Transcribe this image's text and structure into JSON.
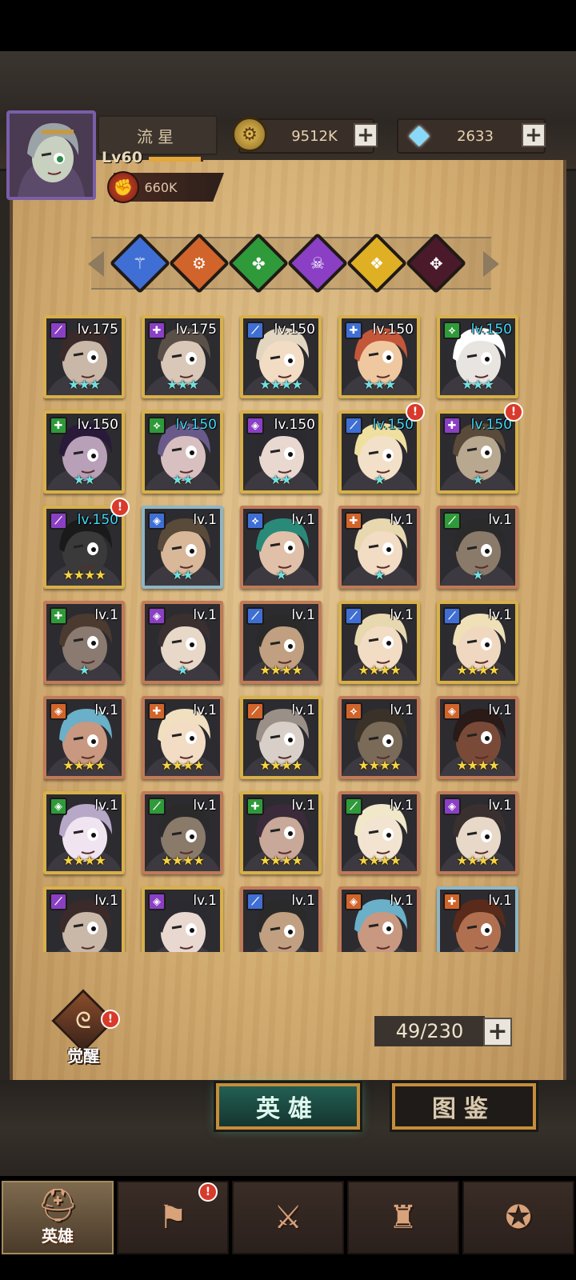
{
  "player": {
    "name": "流星",
    "level": "Lv60",
    "power": "660K",
    "xp_fraction": 0.95
  },
  "resources": {
    "gold": "9512K",
    "diamonds": "2633"
  },
  "factions": [
    {
      "name": "faction-blue",
      "color": "#3f6fd4",
      "glyph": "⚚"
    },
    {
      "name": "faction-orange",
      "color": "#d0642a",
      "glyph": "⚙"
    },
    {
      "name": "faction-green",
      "color": "#2f9a3a",
      "glyph": "✤"
    },
    {
      "name": "faction-purple",
      "color": "#8a3fc4",
      "glyph": "☠"
    },
    {
      "name": "faction-gold",
      "color": "#e0b024",
      "glyph": "❖"
    },
    {
      "name": "faction-dark",
      "color": "#4a1a2a",
      "glyph": "✥"
    }
  ],
  "heroes": [
    {
      "level": "lv.175",
      "stars": "★★★",
      "class_color": "#8a3fc4",
      "class_glyph": "⟋",
      "level_color": "white",
      "star_color": "teal",
      "frame": "gold",
      "skin": "#c9b8a8",
      "hair": "#3a2a2a",
      "badge": false
    },
    {
      "level": "lv.175",
      "stars": "★★★",
      "class_color": "#8a3fc4",
      "class_glyph": "✚",
      "level_color": "white",
      "star_color": "teal",
      "frame": "gold",
      "skin": "#d9c8b8",
      "hair": "#5a5048",
      "badge": false
    },
    {
      "level": "lv.150",
      "stars": "★★★★",
      "class_color": "#3f6fd4",
      "class_glyph": "⟋",
      "level_color": "white",
      "star_color": "teal",
      "frame": "gold",
      "skin": "#f2dcc4",
      "hair": "#e2d6c0",
      "badge": false
    },
    {
      "level": "lv.150",
      "stars": "★★★",
      "class_color": "#3f6fd4",
      "class_glyph": "✚",
      "level_color": "white",
      "star_color": "teal",
      "frame": "gold",
      "skin": "#f0c8a0",
      "hair": "#c4563a",
      "badge": false
    },
    {
      "level": "lv.150",
      "stars": "★★★",
      "class_color": "#2f9a3a",
      "class_glyph": "⟡",
      "level_color": "blue",
      "star_color": "teal",
      "frame": "gold",
      "skin": "#e8e4e0",
      "hair": "#ffffff",
      "badge": false
    },
    {
      "level": "lv.150",
      "stars": "★★",
      "class_color": "#2f9a3a",
      "class_glyph": "✚",
      "level_color": "white",
      "star_color": "teal",
      "frame": "gold",
      "skin": "#b8a0b8",
      "hair": "#2a1a3a",
      "badge": false
    },
    {
      "level": "lv.150",
      "stars": "★★",
      "class_color": "#2f9a3a",
      "class_glyph": "⟡",
      "level_color": "blue",
      "star_color": "teal",
      "frame": "gold",
      "skin": "#d8c0c0",
      "hair": "#6a5a8a",
      "badge": false
    },
    {
      "level": "lv.150",
      "stars": "★★",
      "class_color": "#8a3fc4",
      "class_glyph": "◈",
      "level_color": "white",
      "star_color": "teal",
      "frame": "gold",
      "skin": "#e8d8d0",
      "hair": "#2a2a30",
      "badge": false
    },
    {
      "level": "lv.150",
      "stars": "★",
      "class_color": "#3f6fd4",
      "class_glyph": "⟋",
      "level_color": "blue",
      "star_color": "teal",
      "frame": "gold",
      "skin": "#f2e0c8",
      "hair": "#f0e0a0",
      "badge": true
    },
    {
      "level": "lv.150",
      "stars": "★",
      "class_color": "#8a3fc4",
      "class_glyph": "✚",
      "level_color": "blue",
      "star_color": "teal",
      "frame": "gold",
      "skin": "#b8a890",
      "hair": "#5a4a3a",
      "badge": true
    },
    {
      "level": "lv.150",
      "stars": "★★★★",
      "class_color": "#8a3fc4",
      "class_glyph": "⟋",
      "level_color": "blue",
      "star_color": "gold",
      "frame": "gold",
      "skin": "#3a3a3a",
      "hair": "#1a1a1a",
      "badge": true
    },
    {
      "level": "lv.1",
      "stars": "★★",
      "class_color": "#3f6fd4",
      "class_glyph": "◈",
      "level_color": "white",
      "star_color": "teal",
      "frame": "blue",
      "skin": "#d8b898",
      "hair": "#5a4a3a",
      "badge": false
    },
    {
      "level": "lv.1",
      "stars": "★",
      "class_color": "#3f6fd4",
      "class_glyph": "⟡",
      "level_color": "white",
      "star_color": "teal",
      "frame": "copper",
      "skin": "#e0c0a8",
      "hair": "#2a8a7a",
      "badge": false
    },
    {
      "level": "lv.1",
      "stars": "★",
      "class_color": "#d0642a",
      "class_glyph": "✚",
      "level_color": "white",
      "star_color": "teal",
      "frame": "copper",
      "skin": "#f2dcc4",
      "hair": "#e8d8b0",
      "badge": false
    },
    {
      "level": "lv.1",
      "stars": "★",
      "class_color": "#2f9a3a",
      "class_glyph": "⟋",
      "level_color": "white",
      "star_color": "teal",
      "frame": "copper",
      "skin": "#8a7a6a",
      "hair": "#2a2a2a",
      "badge": false
    },
    {
      "level": "lv.1",
      "stars": "★",
      "class_color": "#2f9a3a",
      "class_glyph": "✚",
      "level_color": "white",
      "star_color": "teal",
      "frame": "copper",
      "skin": "#8a7a70",
      "hair": "#4a3a30",
      "badge": false
    },
    {
      "level": "lv.1",
      "stars": "★",
      "class_color": "#8a3fc4",
      "class_glyph": "◈",
      "level_color": "white",
      "star_color": "teal",
      "frame": "copper",
      "skin": "#e8d8c8",
      "hair": "#3a3030",
      "badge": false
    },
    {
      "level": "lv.1",
      "stars": "★★★★",
      "class_color": "#3f6fd4",
      "class_glyph": "⟋",
      "level_color": "white",
      "star_color": "gold",
      "frame": "copper",
      "skin": "#c0a080",
      "hair": "#2a2a2a",
      "badge": false
    },
    {
      "level": "lv.1",
      "stars": "★★★★",
      "class_color": "#3f6fd4",
      "class_glyph": "⟋",
      "level_color": "white",
      "star_color": "gold",
      "frame": "gold",
      "skin": "#f2dcc4",
      "hair": "#e8d8b0",
      "badge": false
    },
    {
      "level": "lv.1",
      "stars": "★★★★",
      "class_color": "#3f6fd4",
      "class_glyph": "⟋",
      "level_color": "white",
      "star_color": "gold",
      "frame": "gold",
      "skin": "#f0d8c0",
      "hair": "#f0e0b8",
      "badge": false
    },
    {
      "level": "lv.1",
      "stars": "★★★★",
      "class_color": "#d0642a",
      "class_glyph": "◈",
      "level_color": "white",
      "star_color": "gold",
      "frame": "copper",
      "skin": "#c89880",
      "hair": "#6ab0c8",
      "badge": false
    },
    {
      "level": "lv.1",
      "stars": "★★★★",
      "class_color": "#d0642a",
      "class_glyph": "✚",
      "level_color": "white",
      "star_color": "gold",
      "frame": "copper",
      "skin": "#f2dcc4",
      "hair": "#f0e0c0",
      "badge": false
    },
    {
      "level": "lv.1",
      "stars": "★★★★",
      "class_color": "#d0642a",
      "class_glyph": "⟋",
      "level_color": "white",
      "star_color": "gold",
      "frame": "gold",
      "skin": "#d8d0c8",
      "hair": "#9a9088",
      "badge": false
    },
    {
      "level": "lv.1",
      "stars": "★★★★",
      "class_color": "#d0642a",
      "class_glyph": "⟡",
      "level_color": "white",
      "star_color": "gold",
      "frame": "copper",
      "skin": "#7a6a58",
      "hair": "#3a3228",
      "badge": false
    },
    {
      "level": "lv.1",
      "stars": "★★★★",
      "class_color": "#d0642a",
      "class_glyph": "◈",
      "level_color": "white",
      "star_color": "gold",
      "frame": "copper",
      "skin": "#7a4a38",
      "hair": "#2a1a18",
      "badge": false
    },
    {
      "level": "lv.1",
      "stars": "★★★★",
      "class_color": "#2f9a3a",
      "class_glyph": "◈",
      "level_color": "white",
      "star_color": "gold",
      "frame": "gold",
      "skin": "#f0e4f0",
      "hair": "#b8a8c8",
      "badge": false
    },
    {
      "level": "lv.1",
      "stars": "★★★★",
      "class_color": "#2f9a3a",
      "class_glyph": "⟋",
      "level_color": "white",
      "star_color": "gold",
      "frame": "copper",
      "skin": "#8a7a6a",
      "hair": "#2a2a2a",
      "badge": false
    },
    {
      "level": "lv.1",
      "stars": "★★★★",
      "class_color": "#2f9a3a",
      "class_glyph": "✚",
      "level_color": "white",
      "star_color": "gold",
      "frame": "gold",
      "skin": "#c8a898",
      "hair": "#3a2a3a",
      "badge": false
    },
    {
      "level": "lv.1",
      "stars": "★★★★",
      "class_color": "#2f9a3a",
      "class_glyph": "⟋",
      "level_color": "white",
      "star_color": "gold",
      "frame": "copper",
      "skin": "#f2e4d0",
      "hair": "#f0e8c8",
      "badge": false
    },
    {
      "level": "lv.1",
      "stars": "★★★★",
      "class_color": "#8a3fc4",
      "class_glyph": "◈",
      "level_color": "white",
      "star_color": "gold",
      "frame": "copper",
      "skin": "#e8d8c8",
      "hair": "#3a3030",
      "badge": false
    },
    {
      "level": "lv.1",
      "stars": "",
      "class_color": "#8a3fc4",
      "class_glyph": "⟋",
      "level_color": "white",
      "star_color": "gold",
      "frame": "gold",
      "skin": "#c9b8a8",
      "hair": "#3a2a2a",
      "badge": false
    },
    {
      "level": "lv.1",
      "stars": "",
      "class_color": "#8a3fc4",
      "class_glyph": "◈",
      "level_color": "white",
      "star_color": "gold",
      "frame": "gold",
      "skin": "#e8d8d0",
      "hair": "#2a2a30",
      "badge": false
    },
    {
      "level": "lv.1",
      "stars": "",
      "class_color": "#3f6fd4",
      "class_glyph": "⟋",
      "level_color": "white",
      "star_color": "gold",
      "frame": "copper",
      "skin": "#c0a080",
      "hair": "#2a2a2a",
      "badge": false
    },
    {
      "level": "lv.1",
      "stars": "",
      "class_color": "#d0642a",
      "class_glyph": "◈",
      "level_color": "white",
      "star_color": "gold",
      "frame": "copper",
      "skin": "#c89880",
      "hair": "#6ab0c8",
      "badge": false
    },
    {
      "level": "lv.1",
      "stars": "",
      "class_color": "#d0642a",
      "class_glyph": "✚",
      "level_color": "white",
      "star_color": "gold",
      "frame": "blue",
      "skin": "#b07050",
      "hair": "#5a2a1a",
      "badge": false
    }
  ],
  "awaken": {
    "label": "觉醒",
    "badge": "!"
  },
  "hero_count": "49/230",
  "tabs": {
    "heroes": "英雄",
    "codex": "图鉴"
  },
  "bottom_nav": [
    {
      "name": "heroes",
      "label": "英雄",
      "glyph": "⛑",
      "active": true,
      "badge": false
    },
    {
      "name": "expedition",
      "label": "",
      "glyph": "⚑",
      "active": false,
      "badge": true
    },
    {
      "name": "battle",
      "label": "",
      "glyph": "⚔",
      "active": false,
      "badge": false
    },
    {
      "name": "tower",
      "label": "",
      "glyph": "♜",
      "active": false,
      "badge": false
    },
    {
      "name": "guild",
      "label": "",
      "glyph": "✪",
      "active": false,
      "badge": false
    }
  ]
}
